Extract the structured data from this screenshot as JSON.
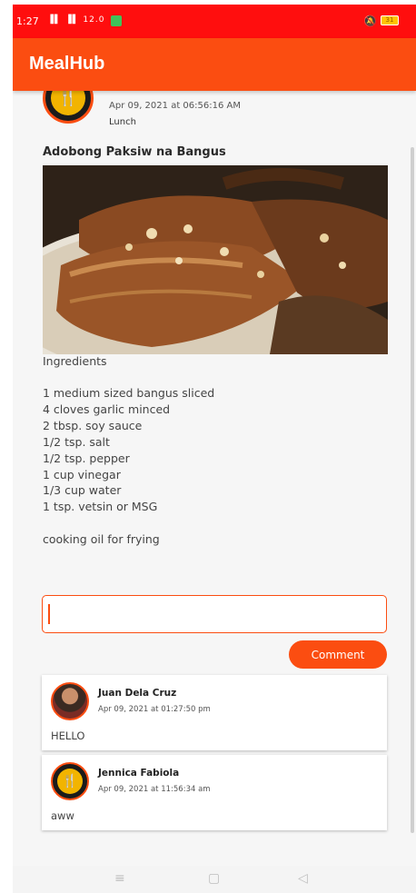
{
  "status_bar": {
    "time": "1:27",
    "signal": "▐▌ ▐▌ 12.0",
    "battery": "31"
  },
  "app_bar": {
    "title": "MealHub"
  },
  "post": {
    "date": "Apr 09, 2021 at 06:56:16 AM",
    "meal_type": "Lunch",
    "title": "Adobong Paksiw na Bangus",
    "ingredients_heading": "Ingredients",
    "ingredients": [
      "1 medium sized bangus sliced",
      "4 cloves garlic minced",
      "2 tbsp. soy sauce",
      "1/2 tsp. salt",
      "1/2 tsp. pepper",
      "1 cup vinegar",
      "1/3 cup water",
      "1 tsp. vetsin or MSG"
    ],
    "extra_note": "cooking oil for frying"
  },
  "comment_form": {
    "input_value": "",
    "button_label": "Comment"
  },
  "comments": [
    {
      "name": "Juan Dela Cruz",
      "time": "Apr 09, 2021 at 01:27:50 pm",
      "text": "HELLO"
    },
    {
      "name": "Jennica Fabiola",
      "time": "Apr 09, 2021 at 11:56:34 am",
      "text": "aww"
    }
  ],
  "icons": {
    "menu": "≡",
    "home": "▢",
    "back": "◁",
    "bell": "🔕",
    "fork": "🍴"
  },
  "colors": {
    "status_bar": "#ff0e0e",
    "accent": "#fb4d11"
  }
}
